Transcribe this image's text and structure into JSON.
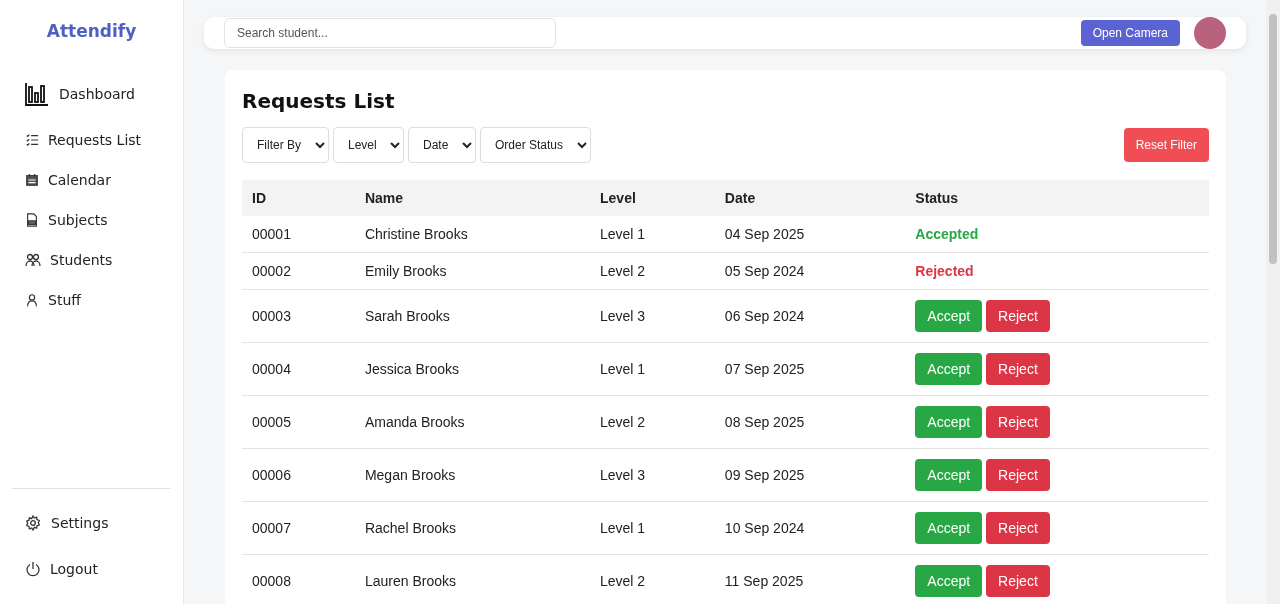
{
  "brand": "Attendify",
  "nav": [
    {
      "label": "Dashboard"
    },
    {
      "label": "Requests List"
    },
    {
      "label": "Calendar"
    },
    {
      "label": "Subjects"
    },
    {
      "label": "Students"
    },
    {
      "label": "Stuff"
    }
  ],
  "footer_nav": [
    {
      "label": "Settings"
    },
    {
      "label": "Logout"
    }
  ],
  "header": {
    "search": {
      "placeholder": "Search student..."
    },
    "camera_button": "Open Camera"
  },
  "requests": {
    "title": "Requests List",
    "filters": [
      "Filter By",
      "Level",
      "Date",
      "Order Status"
    ],
    "reset_button": "Reset Filter",
    "columns": [
      "ID",
      "Name",
      "Level",
      "Date",
      "Status"
    ],
    "rows": [
      {
        "id": "00001",
        "name": "Christine Brooks",
        "level": "Level 1",
        "date": "04 Sep 2025",
        "kind": "status",
        "status": "Accepted",
        "color": "#28a745"
      },
      {
        "id": "00002",
        "name": "Emily Brooks",
        "level": "Level 2",
        "date": "05 Sep 2024",
        "kind": "status",
        "status": "Rejected",
        "color": "#dc3545"
      },
      {
        "id": "00003",
        "name": "Sarah Brooks",
        "level": "Level 3",
        "date": "06 Sep 2024",
        "kind": "actions",
        "accept": "Accept",
        "reject": "Reject"
      },
      {
        "id": "00004",
        "name": "Jessica Brooks",
        "level": "Level 1",
        "date": "07 Sep 2025",
        "kind": "actions",
        "accept": "Accept",
        "reject": "Reject"
      },
      {
        "id": "00005",
        "name": "Amanda Brooks",
        "level": "Level 2",
        "date": "08 Sep 2025",
        "kind": "actions",
        "accept": "Accept",
        "reject": "Reject"
      },
      {
        "id": "00006",
        "name": "Megan Brooks",
        "level": "Level 3",
        "date": "09 Sep 2025",
        "kind": "actions",
        "accept": "Accept",
        "reject": "Reject"
      },
      {
        "id": "00007",
        "name": "Rachel Brooks",
        "level": "Level 1",
        "date": "10 Sep 2024",
        "kind": "actions",
        "accept": "Accept",
        "reject": "Reject"
      },
      {
        "id": "00008",
        "name": "Lauren Brooks",
        "level": "Level 2",
        "date": "11 Sep 2025",
        "kind": "actions",
        "accept": "Accept",
        "reject": "Reject"
      }
    ]
  }
}
